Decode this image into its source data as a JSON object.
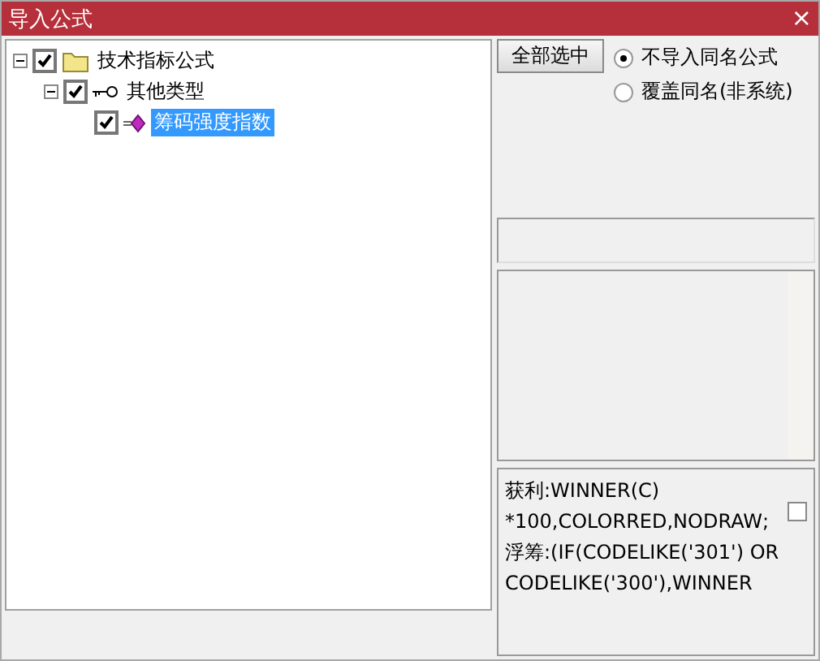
{
  "window": {
    "title": "导入公式",
    "close": "×"
  },
  "tree": [
    {
      "label": "技术指标公式",
      "kind": "folder",
      "checked": true,
      "expanded": true,
      "selected": false,
      "children": [
        {
          "label": "其他类型",
          "kind": "key",
          "checked": true,
          "expanded": true,
          "selected": false,
          "children": [
            {
              "label": "筹码强度指数",
              "kind": "formula",
              "checked": true,
              "selected": true
            }
          ]
        }
      ]
    }
  ],
  "select_all_button": "全部选中",
  "options": [
    {
      "label": "不导入同名公式",
      "selected": true
    },
    {
      "label": "覆盖同名(非系统)",
      "selected": false
    }
  ],
  "formula_text": [
    "获利:WINNER(C)",
    "*100,COLORRED,NODRAW;",
    "浮筹:(IF(CODELIKE('301') OR",
    "CODELIKE('300'),WINNER"
  ],
  "formula_checkbox": {
    "checked": false
  }
}
